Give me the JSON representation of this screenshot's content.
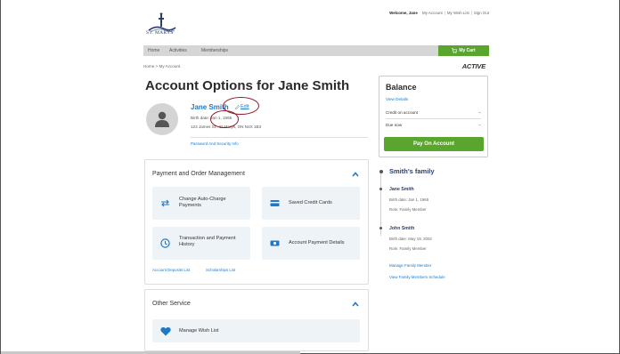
{
  "brand": {
    "logo_text": "ST. MARYS"
  },
  "header": {
    "welcome": "Welcome, Jane",
    "links": [
      "My Account",
      "My Wish List",
      "Sign Out"
    ]
  },
  "nav": {
    "items": [
      "Home",
      "Activities",
      "Memberships"
    ],
    "cart_label": "My Cart"
  },
  "breadcrumb": "Home  >  My Account",
  "active_logo": "ACTIVE",
  "page_title": "Account Options for Jane Smith",
  "profile": {
    "name": "Jane Smith",
    "edit_label": "Edit",
    "birth": "Birth date: Jan 1, 1965",
    "address": "123 James St., St.Marys, ON N4X 1B3",
    "password_link": "Password And Security Info"
  },
  "payment_card": {
    "title": "Payment and Order Management",
    "tiles": [
      {
        "label": "Change Auto-Charge Payments",
        "icon": "swap-arrows-icon"
      },
      {
        "label": "Saved Credit Cards",
        "icon": "credit-card-icon"
      },
      {
        "label": "Transaction and Payment History",
        "icon": "clock-icon"
      },
      {
        "label": "Account Payment Details",
        "icon": "money-icon"
      }
    ],
    "links": [
      "Account Deposits List",
      "Scholarships List"
    ]
  },
  "other_card": {
    "title": "Other Service",
    "tile": {
      "label": "Manage Wish List",
      "icon": "heart-icon"
    }
  },
  "balance": {
    "title": "Balance",
    "view_details": "View Details",
    "rows": [
      {
        "label": "Credit on account",
        "value": "--"
      },
      {
        "label": "Due now",
        "value": "--"
      }
    ],
    "pay_button": "Pay On Account"
  },
  "family": {
    "title": "Smith's family",
    "members": [
      {
        "name": "Jane Smith",
        "birth": "Birth date: Jan 1, 1965",
        "role": "Role: Family Member"
      },
      {
        "name": "John Smith",
        "birth": "Birth date: May 19, 2002",
        "role": "Role: Family Member"
      }
    ],
    "links": [
      "Manage Family Member",
      "View Family Members Schedule"
    ]
  },
  "colors": {
    "accent": "#5aa52e",
    "link": "#1f78c6",
    "annotation": "#8b1a2b",
    "tile_bg": "#eef3f8"
  }
}
